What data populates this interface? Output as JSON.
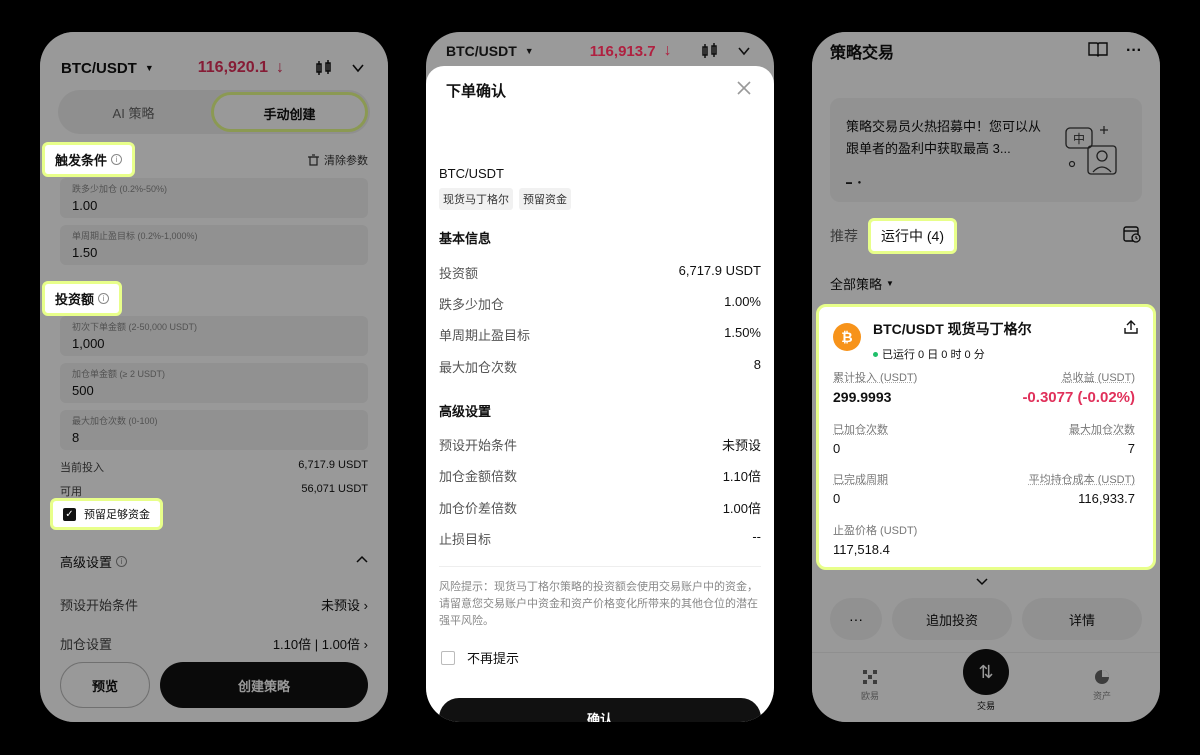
{
  "panel1": {
    "pair": "BTC/USDT",
    "price": "116,920.1",
    "tabs": [
      "AI 策略",
      "手动创建"
    ],
    "trigger_section": "触发条件",
    "clear_params": "清除参数",
    "fields_trigger": [
      {
        "placeholder": "跌多少加仓 (0.2%-50%)",
        "value": "1.00"
      },
      {
        "placeholder": "单周期止盈目标 (0.2%-1,000%)",
        "value": "1.50"
      }
    ],
    "invest_section": "投资额",
    "fields_invest": [
      {
        "placeholder": "初次下单金额 (2-50,000 USDT)",
        "value": "1,000"
      },
      {
        "placeholder": "加仓单金额 (≥ 2 USDT)",
        "value": "500"
      },
      {
        "placeholder": "最大加仓次数 (0-100)",
        "value": "8"
      }
    ],
    "current_invest_label": "当前投入",
    "current_invest_value": "6,717.9 USDT",
    "available_label": "可用",
    "available_value": "56,071 USDT",
    "reserve_label": "预留足够资金",
    "advanced_label": "高级设置",
    "preset_label": "预设开始条件",
    "preset_value": "未预设",
    "add_setting_label": "加仓设置",
    "add_setting_value": "1.10倍 | 1.00倍",
    "preview_btn": "预览",
    "create_btn": "创建策略"
  },
  "panel2": {
    "pair": "BTC/USDT",
    "price": "116,913.7",
    "sheet_title": "下单确认",
    "order_pair": "BTC/USDT",
    "tags": [
      "现货马丁格尔",
      "预留资金"
    ],
    "basic_title": "基本信息",
    "basic_rows": [
      {
        "label": "投资额",
        "value": "6,717.9 USDT"
      },
      {
        "label": "跌多少加仓",
        "value": "1.00%"
      },
      {
        "label": "单周期止盈目标",
        "value": "1.50%"
      },
      {
        "label": "最大加仓次数",
        "value": "8"
      }
    ],
    "adv_title": "高级设置",
    "adv_rows": [
      {
        "label": "预设开始条件",
        "value": "未预设"
      },
      {
        "label": "加仓金额倍数",
        "value": "1.10倍"
      },
      {
        "label": "加仓价差倍数",
        "value": "1.00倍"
      },
      {
        "label": "止损目标",
        "value": "--"
      }
    ],
    "risk_text": "风险提示：现货马丁格尔策略的投资额会使用交易账户中的资金，请留意您交易账户中资金和资产价格变化所带来的其他仓位的潜在强平风险。",
    "no_remind": "不再提示",
    "confirm_btn": "确认"
  },
  "panel3": {
    "title": "策略交易",
    "banner_text": "策略交易员火热招募中！您可以从跟单者的盈利中获取最高 3...",
    "tab_recommend": "推荐",
    "tab_running": "运行中 (4)",
    "filter_label": "全部策略",
    "card": {
      "title": "BTC/USDT 现货马丁格尔",
      "running_time": "已运行 0 日 0 时 0 分",
      "cumulative_label": "累计投入 (USDT)",
      "cumulative_value": "299.9993",
      "total_pnl_label": "总收益 (USDT)",
      "total_pnl_value": "-0.3077 (-0.02%)",
      "added_label": "已加仓次数",
      "added_value": "0",
      "max_add_label": "最大加仓次数",
      "max_add_value": "7",
      "cycles_label": "已完成周期",
      "cycles_value": "0",
      "avg_cost_label": "平均持仓成本 (USDT)",
      "avg_cost_value": "116,933.7",
      "tp_label": "止盈价格 (USDT)",
      "tp_value": "117,518.4"
    },
    "more_btn": "···",
    "add_invest_btn": "追加投资",
    "detail_btn": "详情",
    "tabbar": [
      "欧易",
      "交易",
      "资产"
    ]
  },
  "colors": {
    "highlight": "#e8ff8a",
    "red": "#e0305a",
    "btc": "#f7931a",
    "green": "#1fbf6a"
  }
}
